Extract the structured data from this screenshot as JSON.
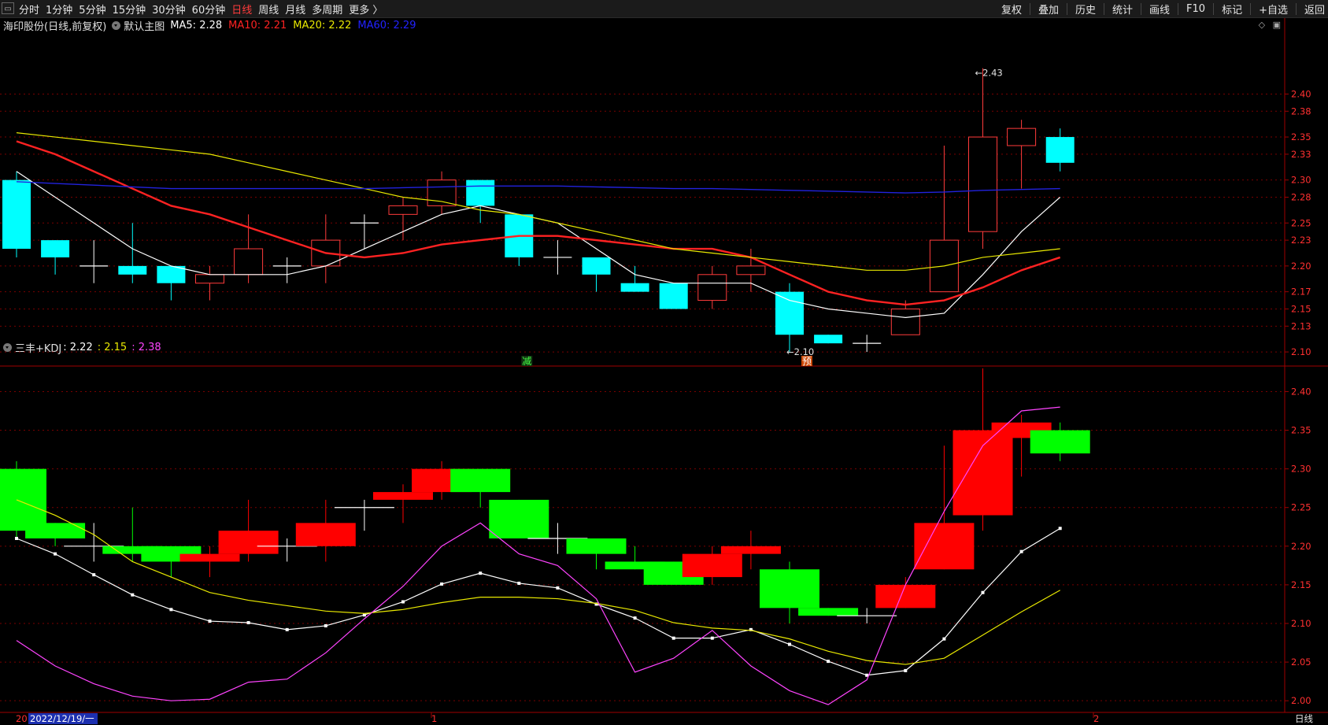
{
  "toolbar": {
    "left_items": [
      "分时",
      "1分钟",
      "5分钟",
      "15分钟",
      "30分钟",
      "60分钟",
      "日线",
      "周线",
      "月线",
      "多周期",
      "更多 〉"
    ],
    "active_index": 6,
    "right_items": [
      "复权",
      "叠加",
      "历史",
      "统计",
      "画线",
      "F10",
      "标记",
      "+自选",
      "返回"
    ]
  },
  "main_panel": {
    "title": "海印股份(日线,前复权)",
    "template": "默认主图",
    "ma_labels": [
      {
        "text": "MA5: 2.28",
        "color": "#ffffff"
      },
      {
        "text": "MA10: 2.21",
        "color": "#ff2222"
      },
      {
        "text": "MA20: 2.22",
        "color": "#e8e800"
      },
      {
        "text": "MA60: 2.29",
        "color": "#2222ff"
      }
    ],
    "high_label": "2.43",
    "low_label": "2.10",
    "marker_jian": "减",
    "marker_yu": "预"
  },
  "sub_panel": {
    "title": "三丰+KDJ",
    "values": [
      {
        "text": ": 2.22",
        "color": "#ffffff"
      },
      {
        "text": ": 2.15",
        "color": "#e8e800"
      },
      {
        "text": ": 2.38",
        "color": "#ff44ff"
      }
    ]
  },
  "bottom_axis": {
    "left_label": "20",
    "date_cursor": "2022/12/19/一",
    "month_label_1": "1",
    "month_label_2": "2",
    "period": "日线"
  },
  "colors": {
    "up": "#ff3b3b",
    "down": "#00ffff",
    "sub_up": "#ff0000",
    "sub_down": "#00ff00",
    "ma5": "#ffffff",
    "ma10": "#ff2222",
    "ma20": "#e8e800",
    "ma60": "#2222dd",
    "grid": "#7a0000"
  },
  "chart_data": [
    {
      "type": "candlestick",
      "title": "海印股份(日线,前复权)",
      "y_ticks": [
        2.1,
        2.13,
        2.15,
        2.17,
        2.2,
        2.23,
        2.25,
        2.28,
        2.3,
        2.33,
        2.35,
        2.38,
        2.4
      ],
      "ylim": [
        2.09,
        2.47
      ],
      "candles": [
        {
          "o": 2.3,
          "h": 2.31,
          "l": 2.21,
          "c": 2.22
        },
        {
          "o": 2.23,
          "h": 2.23,
          "l": 2.19,
          "c": 2.21
        },
        {
          "o": 2.2,
          "h": 2.23,
          "l": 2.18,
          "c": 2.2
        },
        {
          "o": 2.2,
          "h": 2.25,
          "l": 2.18,
          "c": 2.19
        },
        {
          "o": 2.2,
          "h": 2.2,
          "l": 2.16,
          "c": 2.18
        },
        {
          "o": 2.18,
          "h": 2.2,
          "l": 2.16,
          "c": 2.19
        },
        {
          "o": 2.19,
          "h": 2.26,
          "l": 2.18,
          "c": 2.22
        },
        {
          "o": 2.2,
          "h": 2.21,
          "l": 2.18,
          "c": 2.2
        },
        {
          "o": 2.2,
          "h": 2.26,
          "l": 2.18,
          "c": 2.23
        },
        {
          "o": 2.25,
          "h": 2.26,
          "l": 2.22,
          "c": 2.25
        },
        {
          "o": 2.26,
          "h": 2.28,
          "l": 2.23,
          "c": 2.27
        },
        {
          "o": 2.27,
          "h": 2.31,
          "l": 2.26,
          "c": 2.3
        },
        {
          "o": 2.3,
          "h": 2.3,
          "l": 2.25,
          "c": 2.27
        },
        {
          "o": 2.26,
          "h": 2.26,
          "l": 2.2,
          "c": 2.21
        },
        {
          "o": 2.21,
          "h": 2.23,
          "l": 2.19,
          "c": 2.21
        },
        {
          "o": 2.21,
          "h": 2.21,
          "l": 2.17,
          "c": 2.19
        },
        {
          "o": 2.18,
          "h": 2.2,
          "l": 2.17,
          "c": 2.17
        },
        {
          "o": 2.18,
          "h": 2.18,
          "l": 2.15,
          "c": 2.15
        },
        {
          "o": 2.16,
          "h": 2.2,
          "l": 2.15,
          "c": 2.19
        },
        {
          "o": 2.19,
          "h": 2.22,
          "l": 2.17,
          "c": 2.2
        },
        {
          "o": 2.17,
          "h": 2.18,
          "l": 2.1,
          "c": 2.12
        },
        {
          "o": 2.12,
          "h": 2.12,
          "l": 2.11,
          "c": 2.11
        },
        {
          "o": 2.11,
          "h": 2.12,
          "l": 2.1,
          "c": 2.11
        },
        {
          "o": 2.12,
          "h": 2.16,
          "l": 2.12,
          "c": 2.15
        },
        {
          "o": 2.17,
          "h": 2.34,
          "l": 2.17,
          "c": 2.23
        },
        {
          "o": 2.24,
          "h": 2.43,
          "l": 2.22,
          "c": 2.35
        },
        {
          "o": 2.34,
          "h": 2.37,
          "l": 2.29,
          "c": 2.36
        },
        {
          "o": 2.35,
          "h": 2.36,
          "l": 2.31,
          "c": 2.32
        }
      ],
      "series": [
        {
          "name": "MA5",
          "values": [
            2.31,
            2.28,
            2.25,
            2.22,
            2.2,
            2.19,
            2.19,
            2.19,
            2.2,
            2.22,
            2.24,
            2.26,
            2.27,
            2.26,
            2.25,
            2.22,
            2.19,
            2.18,
            2.18,
            2.18,
            2.16,
            2.15,
            2.145,
            2.14,
            2.145,
            2.19,
            2.24,
            2.28
          ]
        },
        {
          "name": "MA10",
          "values": [
            2.345,
            2.33,
            2.31,
            2.29,
            2.27,
            2.26,
            2.245,
            2.23,
            2.215,
            2.21,
            2.215,
            2.225,
            2.23,
            2.235,
            2.235,
            2.23,
            2.225,
            2.22,
            2.22,
            2.21,
            2.19,
            2.17,
            2.16,
            2.155,
            2.16,
            2.175,
            2.195,
            2.21
          ]
        },
        {
          "name": "MA20",
          "values": [
            2.355,
            2.35,
            2.345,
            2.34,
            2.335,
            2.33,
            2.32,
            2.31,
            2.3,
            2.29,
            2.28,
            2.275,
            2.265,
            2.26,
            2.25,
            2.24,
            2.23,
            2.22,
            2.215,
            2.21,
            2.205,
            2.2,
            2.195,
            2.195,
            2.2,
            2.21,
            2.215,
            2.22
          ]
        },
        {
          "name": "MA60",
          "values": [
            2.298,
            2.296,
            2.294,
            2.292,
            2.29,
            2.29,
            2.29,
            2.29,
            2.29,
            2.29,
            2.291,
            2.292,
            2.293,
            2.293,
            2.293,
            2.292,
            2.291,
            2.29,
            2.29,
            2.289,
            2.288,
            2.287,
            2.286,
            2.285,
            2.286,
            2.288,
            2.289,
            2.29
          ]
        }
      ]
    },
    {
      "type": "candlestick",
      "title": "三丰+KDJ",
      "y_ticks": [
        2.0,
        2.05,
        2.1,
        2.15,
        2.2,
        2.25,
        2.3,
        2.35,
        2.4
      ],
      "ylim": [
        1.99,
        2.43
      ],
      "candles": [
        {
          "o": 2.3,
          "h": 2.31,
          "l": 2.21,
          "c": 2.22
        },
        {
          "o": 2.23,
          "h": 2.23,
          "l": 2.2,
          "c": 2.21
        },
        {
          "o": 2.2,
          "h": 2.23,
          "l": 2.18,
          "c": 2.2
        },
        {
          "o": 2.2,
          "h": 2.25,
          "l": 2.18,
          "c": 2.19
        },
        {
          "o": 2.2,
          "h": 2.2,
          "l": 2.16,
          "c": 2.18
        },
        {
          "o": 2.18,
          "h": 2.2,
          "l": 2.16,
          "c": 2.19
        },
        {
          "o": 2.19,
          "h": 2.26,
          "l": 2.18,
          "c": 2.22
        },
        {
          "o": 2.2,
          "h": 2.21,
          "l": 2.18,
          "c": 2.2
        },
        {
          "o": 2.2,
          "h": 2.26,
          "l": 2.18,
          "c": 2.23
        },
        {
          "o": 2.25,
          "h": 2.26,
          "l": 2.22,
          "c": 2.25
        },
        {
          "o": 2.26,
          "h": 2.28,
          "l": 2.23,
          "c": 2.27
        },
        {
          "o": 2.27,
          "h": 2.31,
          "l": 2.26,
          "c": 2.3
        },
        {
          "o": 2.3,
          "h": 2.3,
          "l": 2.25,
          "c": 2.27
        },
        {
          "o": 2.26,
          "h": 2.26,
          "l": 2.21,
          "c": 2.21
        },
        {
          "o": 2.21,
          "h": 2.23,
          "l": 2.19,
          "c": 2.21
        },
        {
          "o": 2.21,
          "h": 2.21,
          "l": 2.17,
          "c": 2.19
        },
        {
          "o": 2.18,
          "h": 2.2,
          "l": 2.17,
          "c": 2.17
        },
        {
          "o": 2.18,
          "h": 2.18,
          "l": 2.15,
          "c": 2.15
        },
        {
          "o": 2.16,
          "h": 2.2,
          "l": 2.15,
          "c": 2.19
        },
        {
          "o": 2.19,
          "h": 2.22,
          "l": 2.17,
          "c": 2.2
        },
        {
          "o": 2.17,
          "h": 2.18,
          "l": 2.1,
          "c": 2.12
        },
        {
          "o": 2.12,
          "h": 2.12,
          "l": 2.11,
          "c": 2.11
        },
        {
          "o": 2.11,
          "h": 2.12,
          "l": 2.1,
          "c": 2.11
        },
        {
          "o": 2.12,
          "h": 2.16,
          "l": 2.12,
          "c": 2.15
        },
        {
          "o": 2.17,
          "h": 2.33,
          "l": 2.17,
          "c": 2.23
        },
        {
          "o": 2.24,
          "h": 2.43,
          "l": 2.22,
          "c": 2.35
        },
        {
          "o": 2.34,
          "h": 2.37,
          "l": 2.29,
          "c": 2.36
        },
        {
          "o": 2.35,
          "h": 2.36,
          "l": 2.31,
          "c": 2.32
        }
      ],
      "series": [
        {
          "name": "K",
          "values": [
            2.21,
            2.19,
            2.163,
            2.137,
            2.118,
            2.103,
            2.101,
            2.092,
            2.097,
            2.111,
            2.128,
            2.151,
            2.165,
            2.152,
            2.146,
            2.125,
            2.107,
            2.081,
            2.081,
            2.092,
            2.073,
            2.051,
            2.033,
            2.039,
            2.08,
            2.14,
            2.193,
            2.223
          ]
        },
        {
          "name": "D",
          "values": [
            2.26,
            2.24,
            2.215,
            2.18,
            2.16,
            2.14,
            2.13,
            2.123,
            2.116,
            2.113,
            2.118,
            2.127,
            2.134,
            2.134,
            2.132,
            2.126,
            2.117,
            2.101,
            2.094,
            2.091,
            2.08,
            2.064,
            2.052,
            2.047,
            2.055,
            2.085,
            2.115,
            2.143
          ]
        },
        {
          "name": "J",
          "values": [
            2.078,
            2.045,
            2.022,
            2.006,
            2.0,
            2.002,
            2.024,
            2.028,
            2.062,
            2.106,
            2.148,
            2.2,
            2.23,
            2.19,
            2.175,
            2.132,
            2.037,
            2.055,
            2.091,
            2.045,
            2.013,
            1.995,
            2.027,
            2.15,
            2.245,
            2.33,
            2.375,
            2.38
          ]
        }
      ]
    }
  ]
}
